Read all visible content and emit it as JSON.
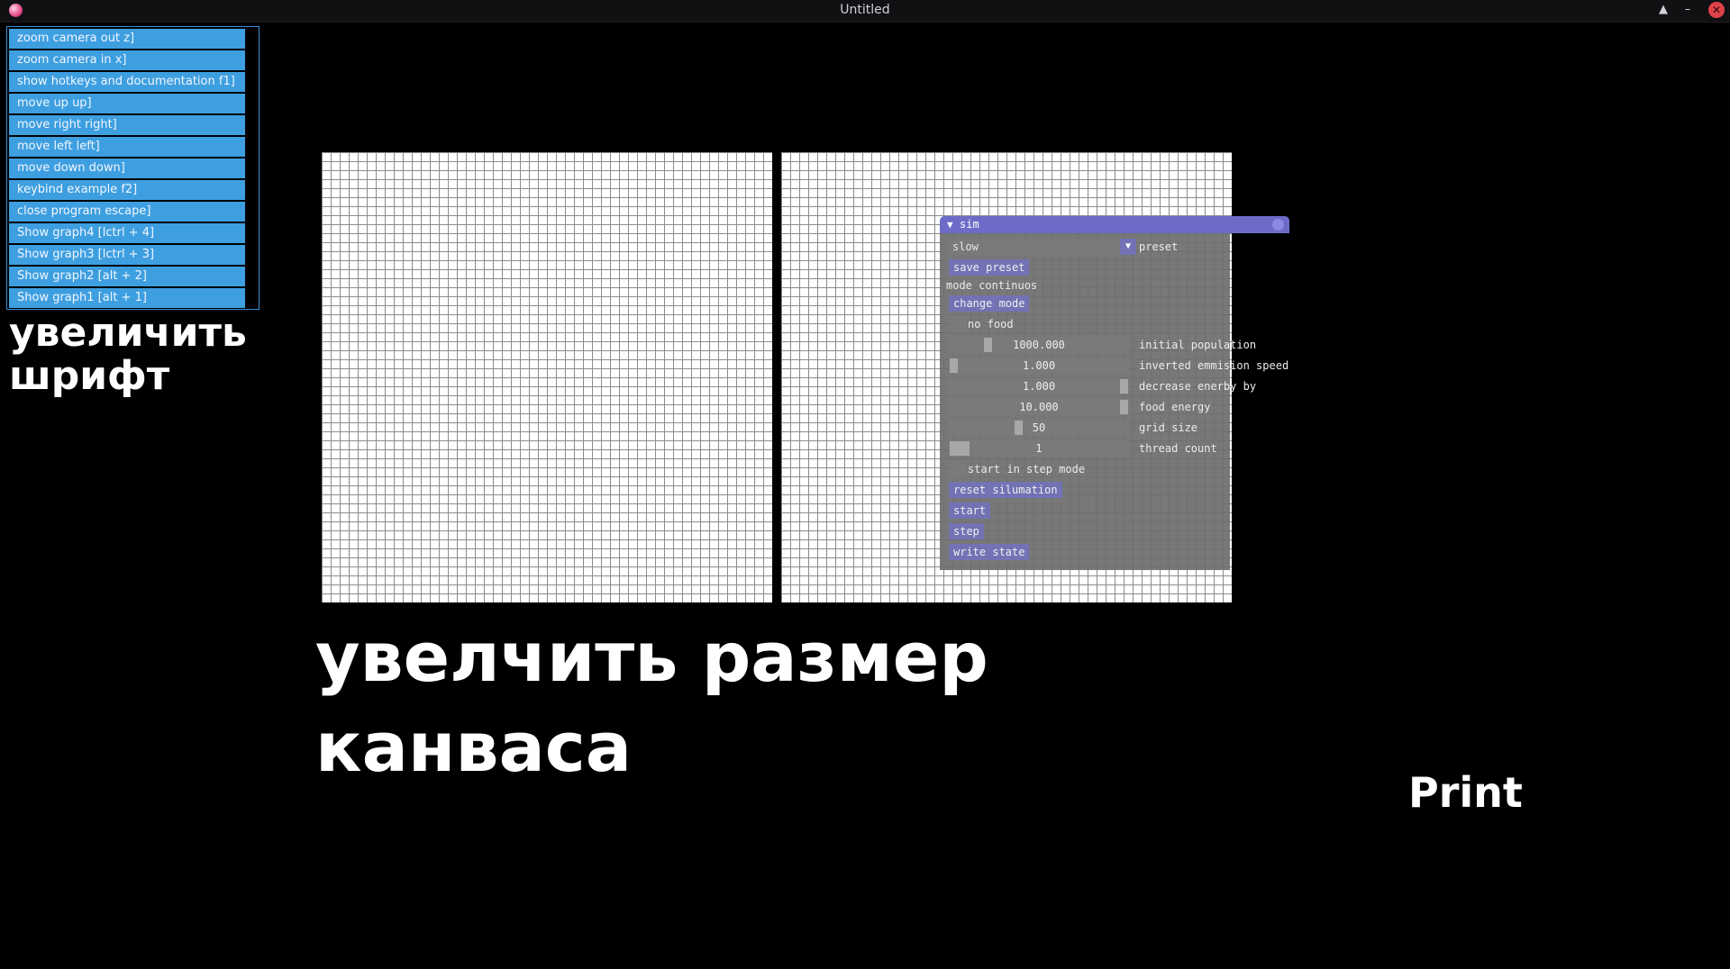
{
  "window": {
    "title": "Untitled",
    "controls": [
      "▲",
      "–",
      "✕"
    ]
  },
  "hotkeys": [
    "zoom camera out z]",
    "zoom camera in x]",
    "show hotkeys and documentation f1]",
    "move up up]",
    "move right right]",
    "move left left]",
    "move down down]",
    "keybind example f2]",
    "close program escape]",
    "Show graph4 [lctrl + 4]",
    "Show graph3 [lctrl + 3]",
    "Show graph2 [alt + 2]",
    "Show graph1 [alt + 1]"
  ],
  "sim": {
    "title": "sim",
    "preset_value": "slow",
    "preset_label": "preset",
    "save_preset": "save preset",
    "mode_text": "mode continuos",
    "change_mode": "change mode",
    "no_food": "no food",
    "fields": [
      {
        "value": "1000.000",
        "label": "initial population",
        "level": 0.2
      },
      {
        "value": "1.000",
        "label": "inverted emmision speed",
        "level": 0.0
      },
      {
        "value": "1.000",
        "label": "decrease enerby by",
        "level": 1.0
      },
      {
        "value": "10.000",
        "label": "food energy",
        "level": 1.0
      },
      {
        "value": "50",
        "label": "grid size",
        "level": 0.38
      },
      {
        "value": "1",
        "label": "thread count",
        "level": 0.0
      }
    ],
    "start_in_step_mode": "start in step mode",
    "reset_simulation": "reset silumation",
    "start": "start",
    "step": "step",
    "write_state": "write state"
  },
  "annotations": {
    "note_font": "увеличить шрифт",
    "note_canvas": "увелчить размер канваса",
    "print": "Print"
  }
}
